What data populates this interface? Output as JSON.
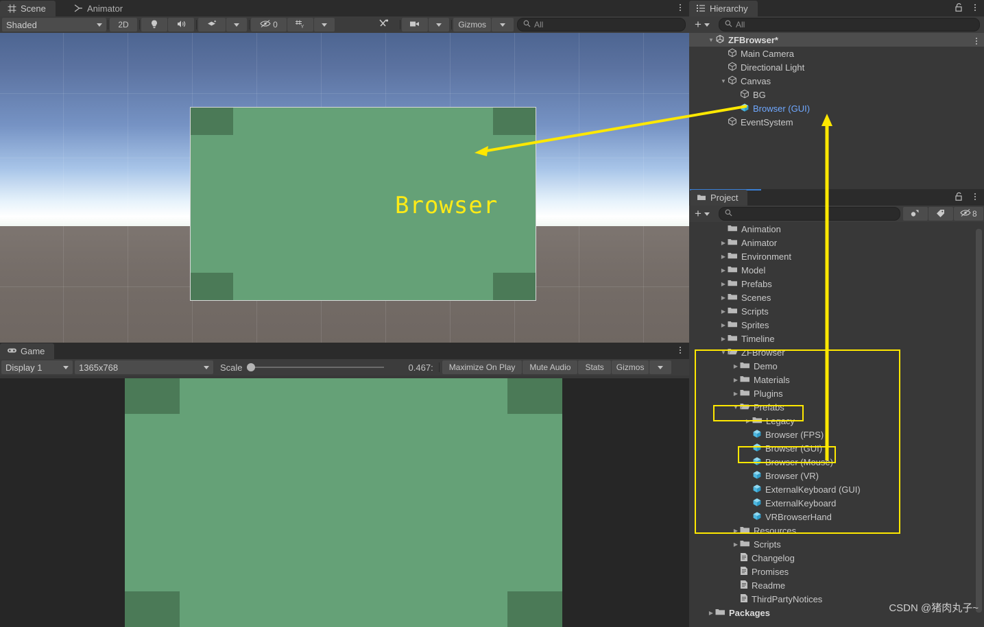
{
  "scene_panel": {
    "tabs": [
      {
        "label": "Scene",
        "icon": "grid-icon",
        "active": true
      },
      {
        "label": "Animator",
        "icon": "animator-icon",
        "active": false
      }
    ],
    "toolbar": {
      "shading_mode": "Shaded",
      "view_2d": "2D",
      "lighting_icon": "lightbulb-icon",
      "audio_icon": "speaker-icon",
      "fx_icon": "effects-icon",
      "hidden_objects_icon": "eye-off-icon",
      "hidden_objects_count": "0",
      "grid_icon": "grid-axis-icon",
      "tools_icon": "tools-icon",
      "camera_icon": "camera-icon",
      "gizmos_label": "Gizmos",
      "search_placeholder": "All",
      "search_value": "",
      "menu_icon": "kebab-icon"
    },
    "viewport": {
      "object_label": "Browser",
      "label_color": "#ffeb17",
      "rect_color": "#65a177",
      "corner_color": "#4b7a57"
    }
  },
  "game_panel": {
    "tab": {
      "label": "Game",
      "icon": "gamepad-icon"
    },
    "toolbar": {
      "display": "Display 1",
      "resolution": "1365x768",
      "scale_label": "Scale",
      "scale_value": "0.467:",
      "maximize_on_play": "Maximize On Play",
      "mute_audio": "Mute Audio",
      "stats": "Stats",
      "gizmos": "Gizmos",
      "menu_icon": "kebab-icon"
    }
  },
  "hierarchy_panel": {
    "tab": {
      "label": "Hierarchy",
      "icon": "hierarchy-icon"
    },
    "lock_icon": "lock-icon",
    "menu_icon": "kebab-icon",
    "toolbar": {
      "add_label": "+",
      "search_placeholder": "All",
      "search_value": ""
    },
    "items": [
      {
        "label": "ZFBrowser*",
        "icon": "unity-scene-icon",
        "indent": 0,
        "arrow": "down",
        "selected": true,
        "bold": true,
        "color": "white"
      },
      {
        "label": "Main Camera",
        "icon": "gameobject-icon",
        "indent": 1,
        "arrow": "none",
        "selected": false,
        "bold": false,
        "color": "grey"
      },
      {
        "label": "Directional Light",
        "icon": "gameobject-icon",
        "indent": 1,
        "arrow": "none",
        "selected": false,
        "bold": false,
        "color": "grey"
      },
      {
        "label": "Canvas",
        "icon": "gameobject-icon",
        "indent": 1,
        "arrow": "down",
        "selected": false,
        "bold": false,
        "color": "grey"
      },
      {
        "label": "BG",
        "icon": "gameobject-icon",
        "indent": 2,
        "arrow": "none",
        "selected": false,
        "bold": false,
        "color": "grey"
      },
      {
        "label": "Browser (GUI)",
        "icon": "prefab-icon",
        "indent": 2,
        "arrow": "none",
        "selected": false,
        "bold": false,
        "color": "blue"
      },
      {
        "label": "EventSystem",
        "icon": "gameobject-icon",
        "indent": 1,
        "arrow": "none",
        "selected": false,
        "bold": false,
        "color": "grey"
      }
    ]
  },
  "project_panel": {
    "tab": {
      "label": "Project",
      "icon": "folder-icon"
    },
    "lock_icon": "lock-icon",
    "menu_icon": "kebab-icon",
    "toolbar": {
      "add_label": "+",
      "search_placeholder": "",
      "search_value": "",
      "filter_type_icon": "object-filter-icon",
      "filter_label_icon": "tag-icon",
      "hidden_icon": "eye-off-icon",
      "hidden_count": "8"
    },
    "items": [
      {
        "label": "Animation",
        "icon": "folder-icon",
        "indent": 1,
        "arrow": "none"
      },
      {
        "label": "Animator",
        "icon": "folder-icon",
        "indent": 1,
        "arrow": "right"
      },
      {
        "label": "Environment",
        "icon": "folder-icon",
        "indent": 1,
        "arrow": "right"
      },
      {
        "label": "Model",
        "icon": "folder-icon",
        "indent": 1,
        "arrow": "right"
      },
      {
        "label": "Prefabs",
        "icon": "folder-icon",
        "indent": 1,
        "arrow": "right"
      },
      {
        "label": "Scenes",
        "icon": "folder-icon",
        "indent": 1,
        "arrow": "right"
      },
      {
        "label": "Scripts",
        "icon": "folder-icon",
        "indent": 1,
        "arrow": "right"
      },
      {
        "label": "Sprites",
        "icon": "folder-icon",
        "indent": 1,
        "arrow": "right"
      },
      {
        "label": "Timeline",
        "icon": "folder-icon",
        "indent": 1,
        "arrow": "right"
      },
      {
        "label": "ZFBrowser",
        "icon": "folder-open-icon",
        "indent": 1,
        "arrow": "down"
      },
      {
        "label": "Demo",
        "icon": "folder-icon",
        "indent": 2,
        "arrow": "right"
      },
      {
        "label": "Materials",
        "icon": "folder-icon",
        "indent": 2,
        "arrow": "right"
      },
      {
        "label": "Plugins",
        "icon": "folder-icon",
        "indent": 2,
        "arrow": "right"
      },
      {
        "label": "Prefabs",
        "icon": "folder-open-icon",
        "indent": 2,
        "arrow": "down"
      },
      {
        "label": "Legacy",
        "icon": "folder-icon",
        "indent": 3,
        "arrow": "right"
      },
      {
        "label": "Browser (FPS)",
        "icon": "prefab-icon",
        "indent": 3,
        "arrow": "none"
      },
      {
        "label": "Browser (GUI)",
        "icon": "prefab-icon",
        "indent": 3,
        "arrow": "none"
      },
      {
        "label": "Browser (Mouse)",
        "icon": "prefab-icon",
        "indent": 3,
        "arrow": "none"
      },
      {
        "label": "Browser (VR)",
        "icon": "prefab-icon",
        "indent": 3,
        "arrow": "none"
      },
      {
        "label": "ExternalKeyboard (GUI)",
        "icon": "prefab-icon",
        "indent": 3,
        "arrow": "none"
      },
      {
        "label": "ExternalKeyboard",
        "icon": "prefab-icon",
        "indent": 3,
        "arrow": "none"
      },
      {
        "label": "VRBrowserHand",
        "icon": "prefab-icon",
        "indent": 3,
        "arrow": "none"
      },
      {
        "label": "Resources",
        "icon": "folder-icon",
        "indent": 2,
        "arrow": "right"
      },
      {
        "label": "Scripts",
        "icon": "folder-icon",
        "indent": 2,
        "arrow": "right"
      },
      {
        "label": "Changelog",
        "icon": "text-file-icon",
        "indent": 2,
        "arrow": "none"
      },
      {
        "label": "Promises",
        "icon": "text-file-icon",
        "indent": 2,
        "arrow": "none"
      },
      {
        "label": "Readme",
        "icon": "text-file-icon",
        "indent": 2,
        "arrow": "none"
      },
      {
        "label": "ThirdPartyNotices",
        "icon": "text-file-icon",
        "indent": 2,
        "arrow": "none"
      },
      {
        "label": "Packages",
        "icon": "folder-icon",
        "indent": 0,
        "arrow": "right",
        "bold": true
      }
    ]
  },
  "annotations": {
    "color": "#ffe800",
    "arrow_to_scene_label": "arrow pointing from Browser (GUI) in Hierarchy to Browser label in Scene",
    "arrow_from_project_to_hierarchy": "vertical arrow from Browser (GUI) prefab up to Browser (GUI) hierarchy item",
    "boxes": [
      "ZFBrowser folder group",
      "Prefabs folder",
      "Browser (GUI) prefab"
    ]
  },
  "watermark": {
    "text": "CSDN @猪肉丸子~"
  }
}
